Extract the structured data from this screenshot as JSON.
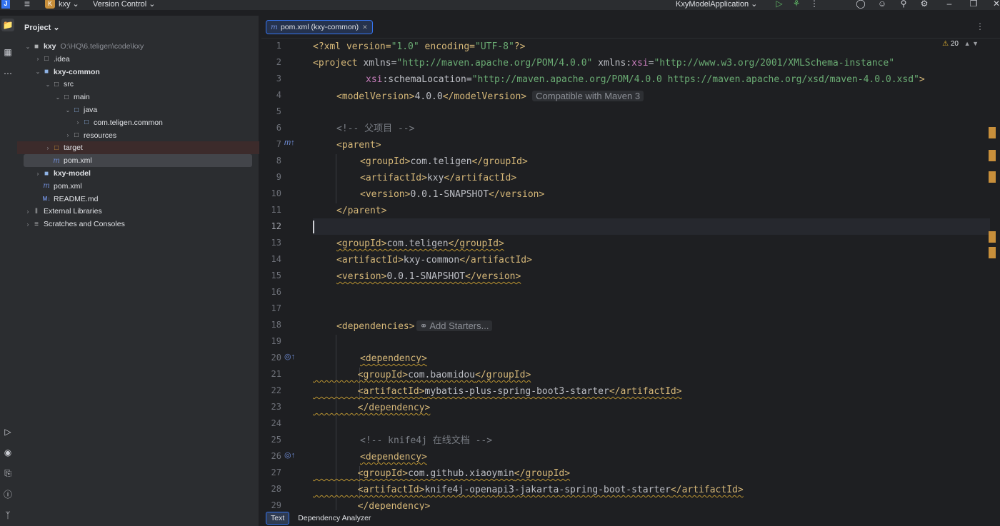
{
  "titlebar": {
    "project_badge": "K",
    "project_name": "kxy ⌄",
    "vcs": "Version Control ⌄",
    "run_config": "KxyModelApplication ⌄"
  },
  "project_panel": {
    "header": "Project ⌄",
    "tree": [
      {
        "label": "kxy",
        "path": "O:\\HQ\\6.teligen\\code\\kxy",
        "indent": 0,
        "chev": "⌄",
        "icon": "folder-icon",
        "glyph": "■",
        "bold": true
      },
      {
        "label": ".idea",
        "path": "",
        "indent": 1,
        "chev": "›",
        "icon": "folder-icon",
        "glyph": "□",
        "bold": false
      },
      {
        "label": "kxy-common",
        "path": "",
        "indent": 1,
        "chev": "⌄",
        "icon": "module-folder-icon",
        "glyph": "■",
        "bold": true
      },
      {
        "label": "src",
        "path": "",
        "indent": 2,
        "chev": "⌄",
        "icon": "folder-icon",
        "glyph": "□",
        "bold": false
      },
      {
        "label": "main",
        "path": "",
        "indent": 3,
        "chev": "⌄",
        "icon": "folder-icon",
        "glyph": "□",
        "bold": false
      },
      {
        "label": "java",
        "path": "",
        "indent": 4,
        "chev": "⌄",
        "icon": "source-folder-icon",
        "glyph": "□",
        "bold": false
      },
      {
        "label": "com.teligen.common",
        "path": "",
        "indent": 5,
        "chev": "›",
        "icon": "package-icon",
        "glyph": "□",
        "bold": false
      },
      {
        "label": "resources",
        "path": "",
        "indent": 4,
        "chev": "›",
        "icon": "resources-folder-icon",
        "glyph": "□",
        "bold": false
      },
      {
        "label": "target",
        "path": "",
        "indent": 2,
        "chev": "›",
        "icon": "excluded-folder-icon",
        "glyph": "□",
        "bold": false
      },
      {
        "label": "pom.xml",
        "path": "",
        "indent": 2,
        "chev": "",
        "icon": "maven-icon",
        "glyph": "m",
        "bold": false
      },
      {
        "label": "kxy-model",
        "path": "",
        "indent": 1,
        "chev": "›",
        "icon": "module-folder-icon",
        "glyph": "■",
        "bold": true
      },
      {
        "label": "pom.xml",
        "path": "",
        "indent": 1,
        "chev": "",
        "icon": "maven-icon",
        "glyph": "m",
        "bold": false
      },
      {
        "label": "README.md",
        "path": "",
        "indent": 1,
        "chev": "",
        "icon": "markdown-icon",
        "glyph": "M↓",
        "bold": false
      },
      {
        "label": "External Libraries",
        "path": "",
        "indent": 0,
        "chev": "›",
        "icon": "library-icon",
        "glyph": "‖",
        "bold": false
      },
      {
        "label": "Scratches and Consoles",
        "path": "",
        "indent": 0,
        "chev": "›",
        "icon": "scratches-icon",
        "glyph": "≡",
        "bold": false
      }
    ]
  },
  "editor": {
    "tab_label": "pom.xml (kxy-common)",
    "warning_count": "20",
    "line_numbers": [
      "1",
      "2",
      "3",
      "4",
      "5",
      "6",
      "7",
      "8",
      "9",
      "10",
      "11",
      "12",
      "13",
      "14",
      "15",
      "16",
      "17",
      "18",
      "19",
      "20",
      "21",
      "22",
      "23",
      "24",
      "25",
      "26",
      "27",
      "28",
      "29"
    ],
    "inlay_maven": "Compatible with Maven 3",
    "inlay_starters": "Add Starters...",
    "lines": {
      "l1a": "<?xml version=",
      "l1b": "\"1.0\"",
      "l1c": " encoding=",
      "l1d": "\"UTF-8\"",
      "l1e": "?>",
      "l2a": "<project ",
      "l2b": "xmlns=",
      "l2c": "\"http://maven.apache.org/POM/4.0.0\"",
      "l2d": " xmlns:",
      "l2e": "xsi",
      "l2f": "=",
      "l2g": "\"http://www.w3.org/2001/XMLSchema-instance\"",
      "l3a": "xsi",
      "l3b": ":schemaLocation=",
      "l3c": "\"http://maven.apache.org/POM/4.0.0 https://maven.apache.org/xsd/maven-4.0.0.xsd\"",
      "l3d": ">",
      "l4a": "<modelVersion>",
      "l4b": "4.0.0",
      "l4c": "</modelVersion>",
      "l6": "<!-- 父项目 -->",
      "l7": "<parent>",
      "l8a": "<groupId>",
      "l8b": "com.teligen",
      "l8c": "</groupId>",
      "l9a": "<artifactId>",
      "l9b": "kxy",
      "l9c": "</artifactId>",
      "l10a": "<version>",
      "l10b": "0.0.1-SNAPSHOT",
      "l10c": "</version>",
      "l11": "</parent>",
      "l13a": "<groupId>",
      "l13b": "com.teligen",
      "l13c": "</groupId>",
      "l14a": "<artifactId>",
      "l14b": "kxy-common",
      "l14c": "</artifactId>",
      "l15a": "<version>",
      "l15b": "0.0.1-SNAPSHOT",
      "l15c": "</version>",
      "l18": "<dependencies>",
      "l20": "<dependency>",
      "l21a": "<groupId>",
      "l21b": "com.baomidou",
      "l21c": "</groupId>",
      "l22a": "<artifactId>",
      "l22b": "mybatis-plus-spring-boot3-starter",
      "l22c": "</artifactId>",
      "l23": "</dependency>",
      "l25": "<!-- knife4j 在线文档 -->",
      "l26": "<dependency>",
      "l27a": "<groupId>",
      "l27b": "com.github.xiaoymin",
      "l27c": "</groupId>",
      "l28a": "<artifactId>",
      "l28b": "knife4j-openapi3-jakarta-spring-boot-starter",
      "l28c": "</artifactId>",
      "l29": "</dependency>"
    }
  },
  "bottom_tabs": [
    "Text",
    "Dependency Analyzer"
  ]
}
